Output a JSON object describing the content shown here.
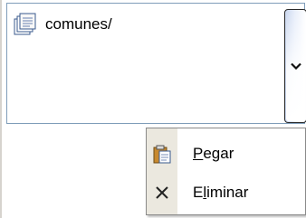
{
  "listbox": {
    "items": [
      {
        "label": "comunes/",
        "icon": "folder-document-icon"
      }
    ],
    "dropdown_icon": "chevron-down-icon"
  },
  "context_menu": {
    "items": [
      {
        "label_pre": "",
        "mnemonic": "P",
        "label_post": "egar",
        "icon": "paste-icon"
      },
      {
        "label_pre": "E",
        "mnemonic": "l",
        "label_post": "iminar",
        "icon": "delete-x-icon"
      }
    ]
  }
}
